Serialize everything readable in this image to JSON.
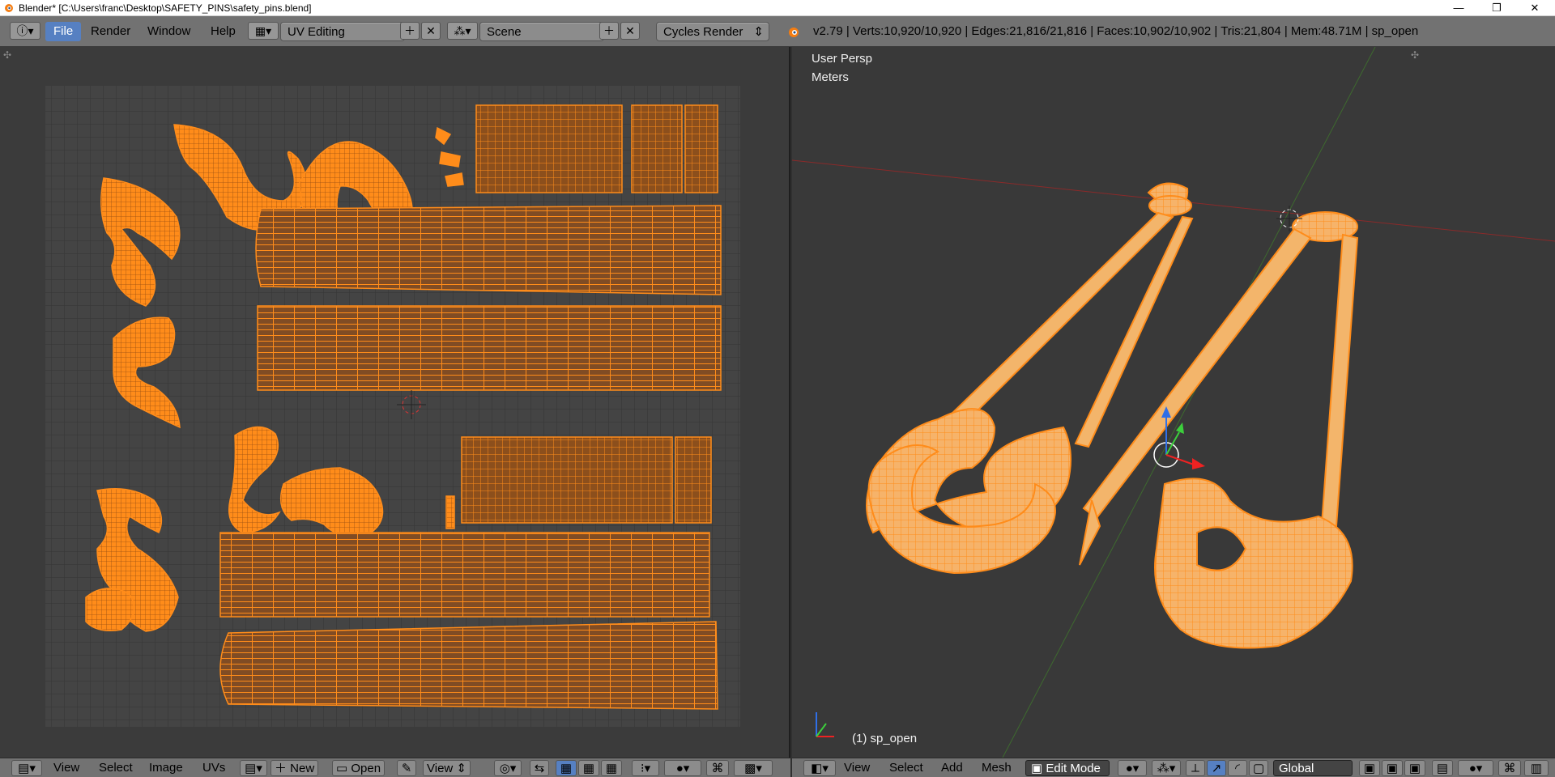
{
  "titlebar": {
    "title": "Blender* [C:\\Users\\franc\\Desktop\\SAFETY_PINS\\safety_pins.blend]",
    "minimize": "—",
    "maximize": "❐",
    "close": "✕"
  },
  "info_header": {
    "menus": [
      "File",
      "Render",
      "Window",
      "Help"
    ],
    "screen_layout": "UV Editing",
    "scene": "Scene",
    "engine": "Cycles Render",
    "stats": "v2.79 | Verts:10,920/10,920 | Edges:21,816/21,816 | Faces:10,902/10,902 | Tris:21,804 | Mem:48.71M | sp_open"
  },
  "viewport": {
    "view_name": "User Persp",
    "units": "Meters",
    "object_label": "(1) sp_open"
  },
  "uv_header": {
    "menus": [
      "View",
      "Select",
      "Image",
      "UVs"
    ],
    "new_label": "New",
    "open_label": "Open",
    "view_label": "View"
  },
  "view3d_header": {
    "menus": [
      "View",
      "Select",
      "Add",
      "Mesh"
    ],
    "mode": "Edit Mode",
    "orientation": "Global"
  },
  "colors": {
    "accent": "#5680c2",
    "uv_mesh": "#ff8c1a",
    "uv_face": "#a25a1c",
    "pin_body": "#f2a24c",
    "grid_bg": "#444444"
  },
  "icons": [
    "blender-logo-icon",
    "info-editor-icon",
    "screen-layout-icon",
    "scene-icon",
    "add-icon",
    "close-icon",
    "blender-render-icon",
    "image-editor-icon",
    "pin-icon",
    "snap-icon",
    "3d-view-icon",
    "pivot-icon",
    "manipulator-icon",
    "vertex-select-icon",
    "edge-select-icon",
    "face-select-icon"
  ]
}
